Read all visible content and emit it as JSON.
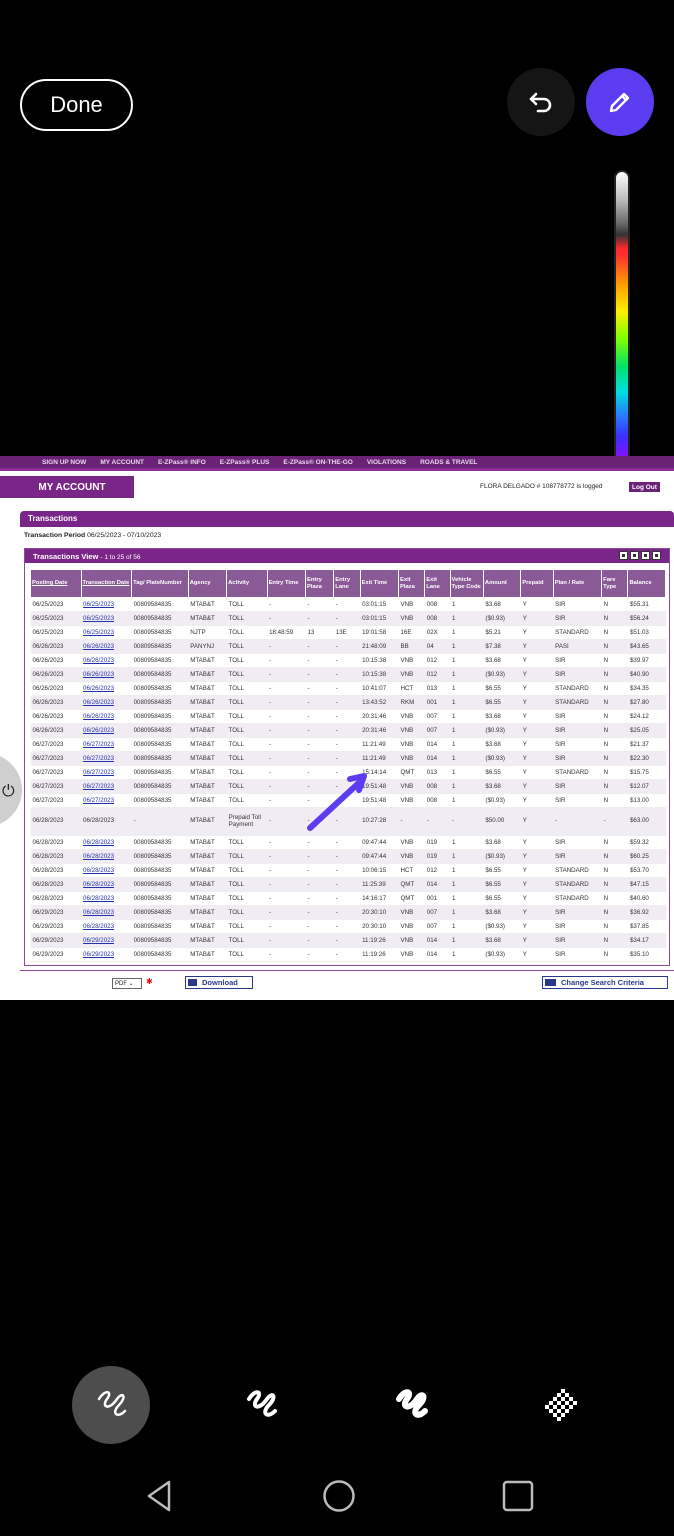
{
  "editor": {
    "done_label": "Done",
    "undo_icon": "undo-icon",
    "pen_icon": "pen-icon"
  },
  "nav_links": [
    "SIGN UP NOW",
    "MY ACCOUNT",
    "E-ZPass® INFO",
    "E-ZPass® PLUS",
    "E-ZPass® ON-THE-GO",
    "VIOLATIONS",
    "ROADS & TRAVEL"
  ],
  "account": {
    "tab_label": "MY ACCOUNT",
    "user_line": "FLORA DELGADO # 108778772 is logged",
    "logout_label": "Log Out"
  },
  "transactions": {
    "title": "Transactions",
    "period_label": "Transaction Period",
    "period_value": "06/25/2023 - 07/10/2023",
    "view_title": "Transactions View",
    "view_range": "- 1 to 25 of 56",
    "columns": [
      "Posting Date",
      "Transaction Date",
      "Tag/ PlateNumber",
      "Agency",
      "Activity",
      "Entry Time",
      "Entry Plaza",
      "Entry Lane",
      "Exit Time",
      "Exit Plaza",
      "Exit Lane",
      "Vehicle Type Code",
      "Amount",
      "Prepaid",
      "Plan / Rate",
      "Fare Type",
      "Balance"
    ],
    "rows": [
      [
        "06/25/2023",
        "06/25/2023",
        "00809584835",
        "MTAB&T",
        "TOLL",
        "-",
        "-",
        "-",
        "03:01:15",
        "VNB",
        "008",
        "1",
        "$3.68",
        "Y",
        "SIR",
        "N",
        "$55.31"
      ],
      [
        "06/25/2023",
        "06/25/2023",
        "00809584835",
        "MTAB&T",
        "TOLL",
        "-",
        "-",
        "-",
        "03:01:15",
        "VNB",
        "008",
        "1",
        "($0.93)",
        "Y",
        "SIR",
        "N",
        "$56.24"
      ],
      [
        "06/25/2023",
        "06/25/2023",
        "00809584835",
        "NJTP",
        "TOLL",
        "18:48:59",
        "13",
        "13E",
        "19:01:58",
        "16E",
        "02X",
        "1",
        "$5.21",
        "Y",
        "STANDARD",
        "N",
        "$51.03"
      ],
      [
        "06/26/2023",
        "06/26/2023",
        "00809584835",
        "PANYNJ",
        "TOLL",
        "-",
        "-",
        "-",
        "21:48:09",
        "BB",
        "04",
        "1",
        "$7.38",
        "Y",
        "PASI",
        "N",
        "$43.65"
      ],
      [
        "06/26/2023",
        "06/26/2023",
        "00809584835",
        "MTAB&T",
        "TOLL",
        "-",
        "-",
        "-",
        "10:15:38",
        "VNB",
        "012",
        "1",
        "$3.68",
        "Y",
        "SIR",
        "N",
        "$39.97"
      ],
      [
        "06/26/2023",
        "06/26/2023",
        "00809584835",
        "MTAB&T",
        "TOLL",
        "-",
        "-",
        "-",
        "10:15:38",
        "VNB",
        "012",
        "1",
        "($0.93)",
        "Y",
        "SIR",
        "N",
        "$40.90"
      ],
      [
        "06/26/2023",
        "06/26/2023",
        "00809584835",
        "MTAB&T",
        "TOLL",
        "-",
        "-",
        "-",
        "10:41:07",
        "HCT",
        "013",
        "1",
        "$6.55",
        "Y",
        "STANDARD",
        "N",
        "$34.35"
      ],
      [
        "06/26/2023",
        "06/26/2023",
        "00809584835",
        "MTAB&T",
        "TOLL",
        "-",
        "-",
        "-",
        "13:43:52",
        "RKM",
        "001",
        "1",
        "$6.55",
        "Y",
        "STANDARD",
        "N",
        "$27.80"
      ],
      [
        "06/26/2023",
        "06/26/2023",
        "00809584835",
        "MTAB&T",
        "TOLL",
        "-",
        "-",
        "-",
        "20:31:46",
        "VNB",
        "007",
        "1",
        "$3.68",
        "Y",
        "SIR",
        "N",
        "$24.12"
      ],
      [
        "06/26/2023",
        "06/26/2023",
        "00809584835",
        "MTAB&T",
        "TOLL",
        "-",
        "-",
        "-",
        "20:31:46",
        "VNB",
        "007",
        "1",
        "($0.93)",
        "Y",
        "SIR",
        "N",
        "$25.05"
      ],
      [
        "06/27/2023",
        "06/27/2023",
        "00809584835",
        "MTAB&T",
        "TOLL",
        "-",
        "-",
        "-",
        "11:21:49",
        "VNB",
        "014",
        "1",
        "$3.68",
        "Y",
        "SIR",
        "N",
        "$21.37"
      ],
      [
        "06/27/2023",
        "06/27/2023",
        "00809584835",
        "MTAB&T",
        "TOLL",
        "-",
        "-",
        "-",
        "11:21:49",
        "VNB",
        "014",
        "1",
        "($0.93)",
        "Y",
        "SIR",
        "N",
        "$22.30"
      ],
      [
        "06/27/2023",
        "06/27/2023",
        "00809584835",
        "MTAB&T",
        "TOLL",
        "-",
        "-",
        "-",
        "15:14:14",
        "QMT",
        "013",
        "1",
        "$6.55",
        "Y",
        "STANDARD",
        "N",
        "$15.75"
      ],
      [
        "06/27/2023",
        "06/27/2023",
        "00809584835",
        "MTAB&T",
        "TOLL",
        "-",
        "-",
        "-",
        "19:51:48",
        "VNB",
        "008",
        "1",
        "$3.68",
        "Y",
        "SIR",
        "N",
        "$12.07"
      ],
      [
        "06/27/2023",
        "06/27/2023",
        "00809584835",
        "MTAB&T",
        "TOLL",
        "-",
        "-",
        "-",
        "19:51:48",
        "VNB",
        "008",
        "1",
        "($0.93)",
        "Y",
        "SIR",
        "N",
        "$13.00"
      ],
      [
        "06/28/2023",
        "06/28/2023",
        "-",
        "MTAB&T",
        "Prepaid Toll Payment",
        "-",
        "-",
        "-",
        "10:27:28",
        "-",
        "-",
        "-",
        "$50.00",
        "Y",
        "-",
        "-",
        "$63.00"
      ],
      [
        "06/28/2023",
        "06/28/2023",
        "00809584835",
        "MTAB&T",
        "TOLL",
        "-",
        "-",
        "-",
        "09:47:44",
        "VNB",
        "019",
        "1",
        "$3.68",
        "Y",
        "SIR",
        "N",
        "$59.32"
      ],
      [
        "06/28/2023",
        "06/28/2023",
        "00809584835",
        "MTAB&T",
        "TOLL",
        "-",
        "-",
        "-",
        "09:47:44",
        "VNB",
        "019",
        "1",
        "($0.93)",
        "Y",
        "SIR",
        "N",
        "$60.25"
      ],
      [
        "06/28/2023",
        "06/28/2023",
        "00809584835",
        "MTAB&T",
        "TOLL",
        "-",
        "-",
        "-",
        "10:06:15",
        "HCT",
        "012",
        "1",
        "$6.55",
        "Y",
        "STANDARD",
        "N",
        "$53.70"
      ],
      [
        "06/28/2023",
        "06/28/2023",
        "00809584835",
        "MTAB&T",
        "TOLL",
        "-",
        "-",
        "-",
        "11:25:39",
        "QMT",
        "014",
        "1",
        "$6.55",
        "Y",
        "STANDARD",
        "N",
        "$47.15"
      ],
      [
        "06/28/2023",
        "06/28/2023",
        "00809584835",
        "MTAB&T",
        "TOLL",
        "-",
        "-",
        "-",
        "14:16:17",
        "QMT",
        "001",
        "1",
        "$6.55",
        "Y",
        "STANDARD",
        "N",
        "$40.60"
      ],
      [
        "06/29/2023",
        "06/28/2023",
        "00809584835",
        "MTAB&T",
        "TOLL",
        "-",
        "-",
        "-",
        "20:30:10",
        "VNB",
        "007",
        "1",
        "$3.68",
        "Y",
        "SIR",
        "N",
        "$36.92"
      ],
      [
        "06/29/2023",
        "06/28/2023",
        "00809584835",
        "MTAB&T",
        "TOLL",
        "-",
        "-",
        "-",
        "20:30:10",
        "VNB",
        "007",
        "1",
        "($0.93)",
        "Y",
        "SIR",
        "N",
        "$37.85"
      ],
      [
        "06/29/2023",
        "06/29/2023",
        "00809584835",
        "MTAB&T",
        "TOLL",
        "-",
        "-",
        "-",
        "11:19:26",
        "VNB",
        "014",
        "1",
        "$3.68",
        "Y",
        "SIR",
        "N",
        "$34.17"
      ],
      [
        "06/29/2023",
        "06/29/2023",
        "00809584835",
        "MTAB&T",
        "TOLL",
        "-",
        "-",
        "-",
        "11:19:26",
        "VNB",
        "014",
        "1",
        "($0.93)",
        "Y",
        "SIR",
        "N",
        "$35.10"
      ]
    ],
    "format_value": "PDF",
    "download_label": "Download",
    "change_label": "Change Search Criteria"
  },
  "brushes": [
    "brush-thin-icon",
    "brush-medium-icon",
    "brush-thick-icon",
    "brush-pixelate-icon"
  ],
  "nav_icons": [
    "back-icon",
    "home-icon",
    "recents-icon"
  ],
  "colors": {
    "pen": "#5b3cf0",
    "purple": "#7a2688",
    "annotation": "#5b3cf0"
  }
}
